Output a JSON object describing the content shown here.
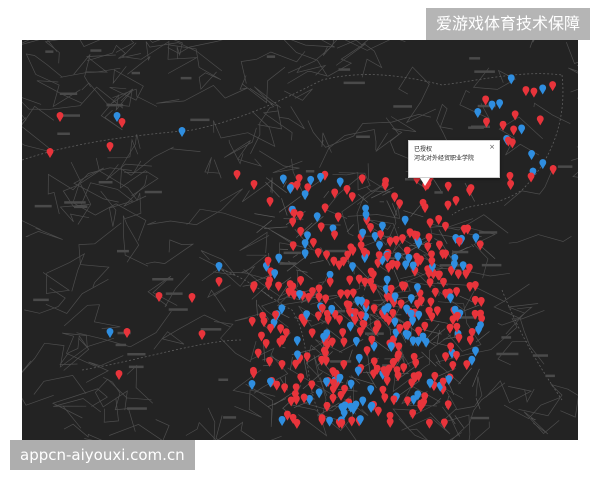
{
  "watermark_top": "爱游戏体育技术保障",
  "watermark_bottom": "appcn-aiyouxi.com.cn",
  "popup": {
    "line1": "已授权",
    "line2": "河北对外经贸职业学院",
    "close_icon": "×"
  },
  "markers": {
    "red_color": "#e8343b",
    "blue_color": "#2f8ee0",
    "icon": "map-pin-icon"
  }
}
